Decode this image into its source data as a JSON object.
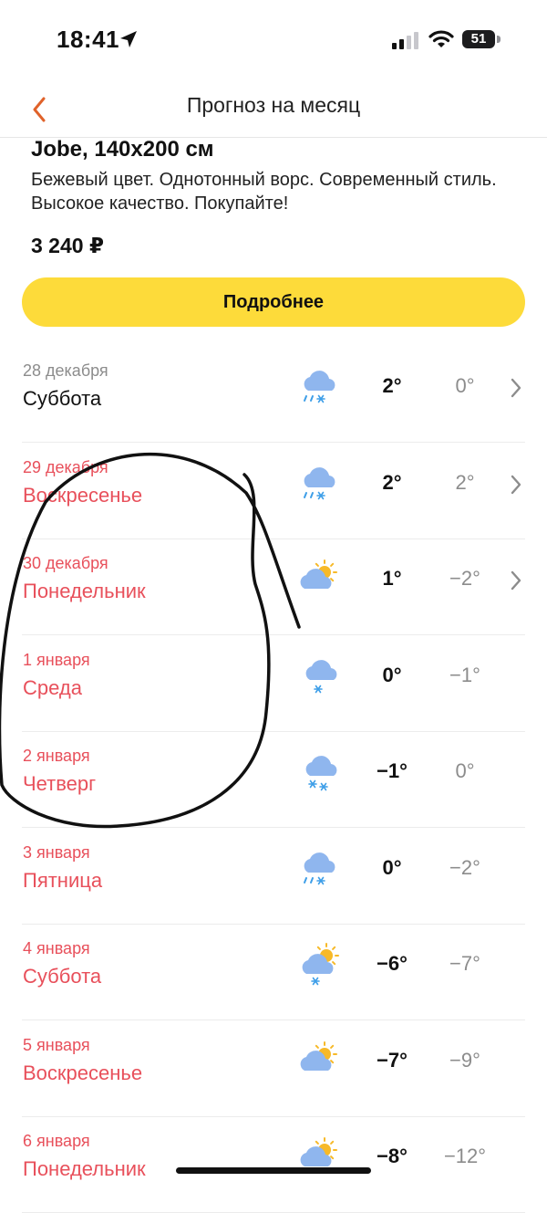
{
  "status": {
    "time": "18:41",
    "battery": "51"
  },
  "nav": {
    "title": "Прогноз на месяц"
  },
  "ad": {
    "title": "Jobe, 140x200 см",
    "description": "Бежевый цвет. Однотонный ворс. Современный стиль. Высокое качество. Покупайте!",
    "price": "3 240 ₽",
    "button_label": "Подробнее"
  },
  "forecast": [
    {
      "date": "28 декабря",
      "day": "Суббота",
      "day_temp": "2°",
      "night_temp": "0°",
      "icon": "cloud-rain-snow-icon",
      "weekend": false,
      "has_chevron": true
    },
    {
      "date": "29 декабря",
      "day": "Воскресенье",
      "day_temp": "2°",
      "night_temp": "2°",
      "icon": "cloud-rain-snow-icon",
      "weekend": true,
      "has_chevron": true
    },
    {
      "date": "30 декабря",
      "day": "Понедельник",
      "day_temp": "1°",
      "night_temp": "−2°",
      "icon": "partly-cloudy-icon",
      "weekend": true,
      "has_chevron": true
    },
    {
      "date": "1 января",
      "day": "Среда",
      "day_temp": "0°",
      "night_temp": "−1°",
      "icon": "cloud-snow-icon",
      "weekend": true,
      "has_chevron": false
    },
    {
      "date": "2 января",
      "day": "Четверг",
      "day_temp": "−1°",
      "night_temp": "0°",
      "icon": "cloud-heavy-snow-icon",
      "weekend": true,
      "has_chevron": false
    },
    {
      "date": "3 января",
      "day": "Пятница",
      "day_temp": "0°",
      "night_temp": "−2°",
      "icon": "cloud-rain-snow-icon",
      "weekend": true,
      "has_chevron": false
    },
    {
      "date": "4 января",
      "day": "Суббота",
      "day_temp": "−6°",
      "night_temp": "−7°",
      "icon": "sun-cloud-snow-icon",
      "weekend": true,
      "has_chevron": false
    },
    {
      "date": "5 января",
      "day": "Воскресенье",
      "day_temp": "−7°",
      "night_temp": "−9°",
      "icon": "partly-cloudy-icon",
      "weekend": true,
      "has_chevron": false
    },
    {
      "date": "6 января",
      "day": "Понедельник",
      "day_temp": "−8°",
      "night_temp": "−12°",
      "icon": "partly-cloudy-icon",
      "weekend": true,
      "has_chevron": false
    }
  ],
  "colors": {
    "accent": "#fddb3a",
    "weekend": "#e8505b",
    "back_arrow": "#e0622a",
    "cloud": "#8fb6ee",
    "sun": "#f7b928",
    "snow": "#3d9ee8"
  }
}
